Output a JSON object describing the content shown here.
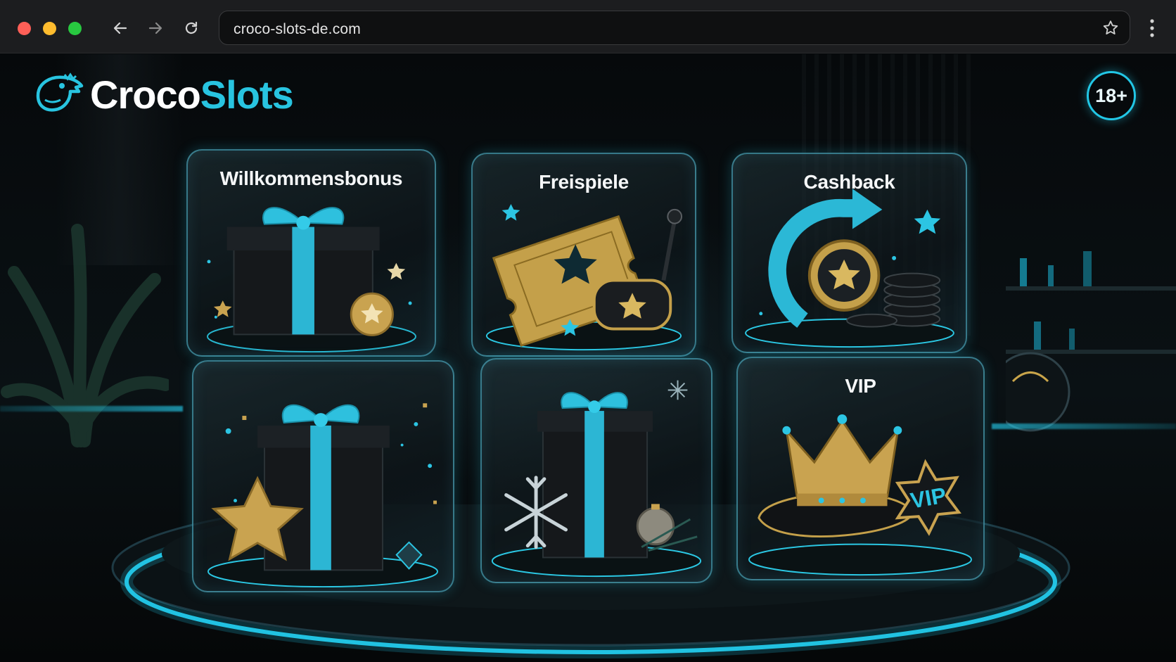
{
  "browser": {
    "url": "croco-slots-de.com",
    "icons": [
      "back-arrow-icon",
      "forward-arrow-icon",
      "reload-icon",
      "bookmark-star-icon",
      "kebab-menu-icon"
    ]
  },
  "brand": {
    "name_part1": "Croco",
    "name_part2": "Slots",
    "logo_icon": "crocodile-icon",
    "accent_color": "#28c4e0"
  },
  "age_badge": {
    "label": "18+"
  },
  "cards": [
    {
      "title": "Willkommensbonus",
      "icon": "gift-box-icon"
    },
    {
      "title": "Freispiele",
      "icon": "golden-ticket-icon"
    },
    {
      "title": "Cashback",
      "icon": "cashback-arrow-icon"
    },
    {
      "title": "",
      "icon": "gift-with-star-icon"
    },
    {
      "title": "",
      "icon": "winter-gift-icon"
    },
    {
      "title": "VIP",
      "icon": "crown-icon",
      "badge": "VIP"
    }
  ]
}
